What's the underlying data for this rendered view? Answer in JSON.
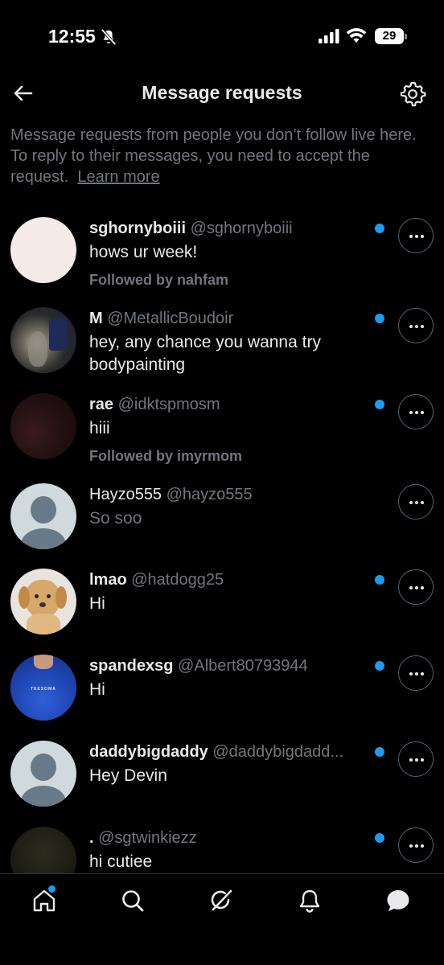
{
  "status_bar": {
    "time": "12:55",
    "battery": "29"
  },
  "header": {
    "title": "Message requests"
  },
  "intro": {
    "text": "Message requests from people you don’t follow live here. To reply to their messages, you need to accept the request.",
    "learn_more": "Learn more"
  },
  "requests": [
    {
      "name": "sghornyboiii",
      "handle": "@sghornyboiii",
      "message": "hows ur week!",
      "followed_by": "Followed by nahfam",
      "unread": true
    },
    {
      "name": "M",
      "handle": "@MetallicBoudoir",
      "message": "hey, any chance you wanna try bodypainting",
      "followed_by": "",
      "unread": true
    },
    {
      "name": "rae",
      "handle": "@idktspmosm",
      "message": "hiii",
      "followed_by": "Followed by imyrmom",
      "unread": true
    },
    {
      "name": "Hayzo555",
      "handle": "@hayzo555",
      "message": "So soo",
      "followed_by": "",
      "unread": false
    },
    {
      "name": "lmao",
      "handle": "@hatdogg25",
      "message": "Hi",
      "followed_by": "",
      "unread": true
    },
    {
      "name": "spandexsg",
      "handle": "@Albert80793944",
      "message": "Hi",
      "followed_by": "",
      "unread": true
    },
    {
      "name": "daddybigdaddy",
      "handle": "@daddybigdadd...",
      "message": "Hey Devin",
      "followed_by": "",
      "unread": true
    },
    {
      "name": ".",
      "handle": "@sgtwinkiezz",
      "message": "hi cutiee",
      "followed_by": "",
      "unread": true
    }
  ],
  "avatar_shirt_text": "TEESOMA",
  "colors": {
    "accent": "#1d9bf0",
    "text": "#e7e9ea",
    "muted": "#71767b",
    "background": "#000000"
  },
  "icons": {
    "back": "arrow-left-icon",
    "settings": "gear-icon",
    "more": "more-horizontal-icon",
    "tabs": [
      "home-icon",
      "search-icon",
      "grok-icon",
      "bell-icon",
      "messages-icon"
    ]
  }
}
